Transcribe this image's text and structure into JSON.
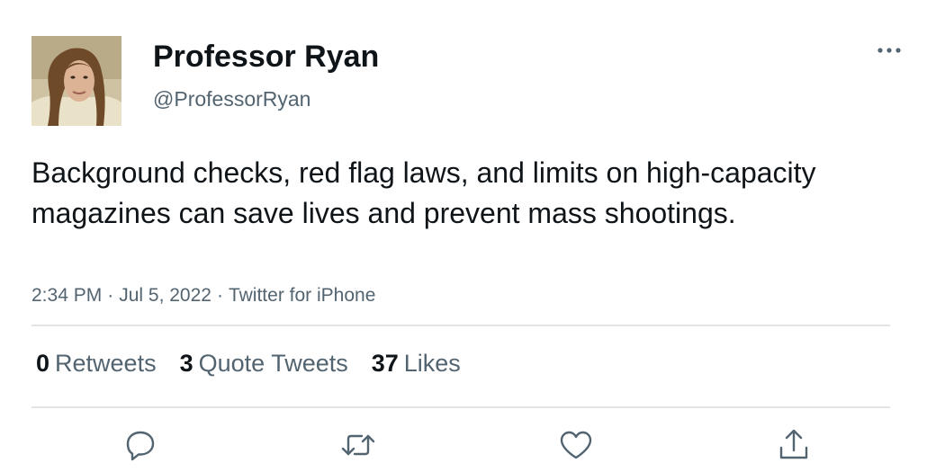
{
  "tweet": {
    "display_name": "Professor Ryan",
    "handle": "@ProfessorRyan",
    "text": "Background checks, red flag laws, and limits on high-capacity magazines can save lives and prevent mass shootings.",
    "time": "2:34 PM",
    "separator": "·",
    "date": "Jul 5, 2022",
    "source": "Twitter for iPhone",
    "more_icon": "more-horizontal-icon"
  },
  "stats": {
    "retweets": {
      "count": "0",
      "label": "Retweets"
    },
    "quote_tweets": {
      "count": "3",
      "label": "Quote Tweets"
    },
    "likes": {
      "count": "37",
      "label": "Likes"
    }
  },
  "actions": [
    {
      "name": "reply",
      "icon": "reply-icon"
    },
    {
      "name": "retweet",
      "icon": "retweet-icon"
    },
    {
      "name": "like",
      "icon": "heart-icon"
    },
    {
      "name": "share",
      "icon": "share-icon"
    }
  ],
  "colors": {
    "text_primary": "#0f1419",
    "text_secondary": "#536471",
    "divider": "#e1e5e8",
    "icon": "#536471"
  }
}
